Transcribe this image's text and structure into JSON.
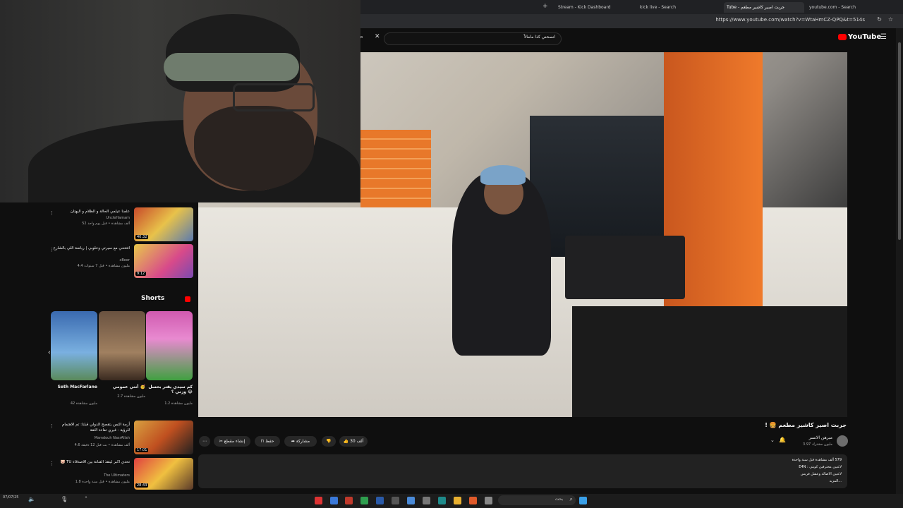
{
  "browser": {
    "tabs": [
      {
        "label": "Stream - Kick Dashboard",
        "active": false
      },
      {
        "label": "kick live - Search",
        "active": false
      },
      {
        "label": "Tube - جربت اصير كاشير مطعم",
        "active": true
      },
      {
        "label": "youtube.com - Search",
        "active": false
      }
    ],
    "url": "https://www.youtube.com/watch?v=WtaHmCZ-QPQ&t=514s"
  },
  "youtube": {
    "logo": "YouTube",
    "search_value": "انصحني كذا مامالاً",
    "video": {
      "title": "جربت اصير كاشير مطعم 🍔 !",
      "channel": "مبرهن الانسر",
      "subscribers": "3.97 مليون مشترك",
      "likes": "30 ألف",
      "actions": {
        "share": "مشاركة",
        "save": "حفظ",
        "clip": "إنشاء مقطع",
        "more": "⋯"
      },
      "description": [
        "579 ألف مشاهدة  قبل سنة واحدة",
        "لاعبين محترفين كويتي : E4N",
        "لاعبين الاصالة وعشل فريس",
        "...المزيد"
      ]
    },
    "sidebar": {
      "recommendations_top": [
        {
          "title": "علمنا عيلمي الحالة و الظلام و اليهتان",
          "channel": "UncleHamam",
          "meta": "52 ألف مشاهدة • قبل يوم واحد",
          "duration": "40:32"
        },
        {
          "title": "افتتحي مع سيرتي وخلوبي | رياضة اللي بالشارع",
          "channel": "xBeer",
          "meta": "4.4 مليون مشاهدة • قبل 7 سنوات",
          "duration": "9:12"
        }
      ],
      "shorts_label": "Shorts",
      "shorts": [
        {
          "title": "Seth MacFarlane",
          "views": "42 مليون مشاهدة",
          "color": "#4a84c4"
        },
        {
          "title": "أنتي عمومي 🥳",
          "views": "2.7 مليون مشاهدة",
          "color": "#8a6a4a"
        },
        {
          "title": "كم سيدي يقتر بحسل وزني ؟ 😂",
          "views": "1.2 مليون مشاهدة",
          "color": "#c04ca0"
        }
      ],
      "recommendations_bottom": [
        {
          "title": "أزمة الثمن يتقصح الدولي قبلنا: تم الاهتمام للرؤية - فيري تفاءة الثقة",
          "channel": "Mamdouh NasrAllah",
          "meta": "4.6 ألف مشاهدة • بث قبل 12 دقيقة",
          "duration": "17:01"
        },
        {
          "title": "تحدي اكبر لينقذ الفنانة بين الاصدقاء TU 🐷",
          "channel": "The Ultimaters",
          "meta": "1.8 مليون مشاهدة • قبل سنة واحدة",
          "duration": "28:43"
        }
      ]
    }
  },
  "taskbar": {
    "search_placeholder": "بحث",
    "clock": "07/07/25"
  }
}
